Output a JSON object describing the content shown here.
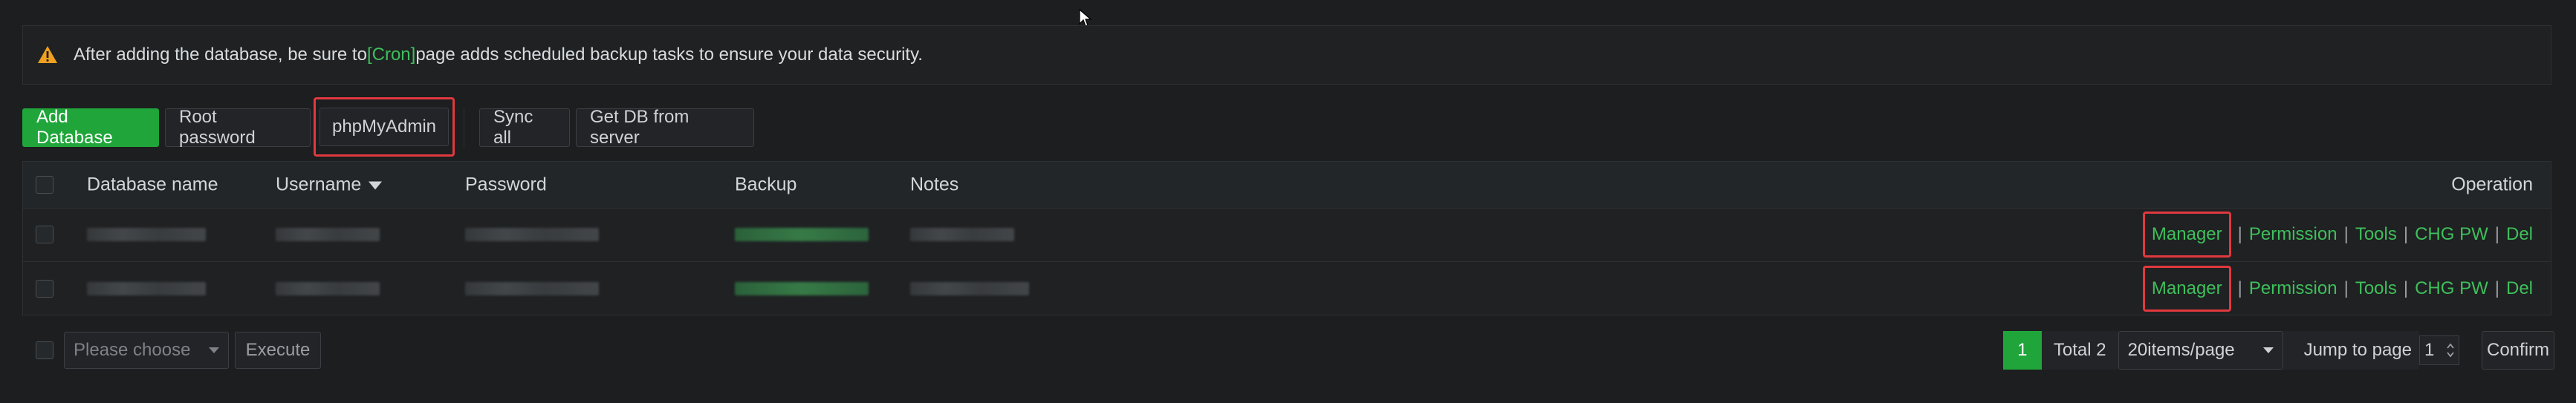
{
  "alert": {
    "text_before": "After adding the database, be sure to ",
    "link": "[Cron]",
    "text_after": " page adds scheduled backup tasks to ensure your data security."
  },
  "toolbar": {
    "add_database": "Add Database",
    "root_password": "Root password",
    "phpmyadmin": "phpMyAdmin",
    "sync_all": "Sync all",
    "get_db_from_server": "Get DB from server"
  },
  "table": {
    "headers": {
      "database_name": "Database name",
      "username": "Username",
      "password": "Password",
      "backup": "Backup",
      "notes": "Notes",
      "operation": "Operation"
    },
    "operations": {
      "manager": "Manager",
      "permission": "Permission",
      "tools": "Tools",
      "chg_pw": "CHG PW",
      "del": "Del",
      "separator": "|"
    }
  },
  "footer": {
    "batch_placeholder": "Please choose",
    "execute": "Execute",
    "current_page": "1",
    "total": "Total 2",
    "per_page": "20items/page",
    "jump_to": "Jump to page",
    "jump_value": "1",
    "confirm": "Confirm"
  },
  "colors": {
    "accent_green": "#20a53a",
    "link_green": "#3fbf5b",
    "highlight_red": "#e0393e",
    "warning_orange": "#f0a020"
  }
}
